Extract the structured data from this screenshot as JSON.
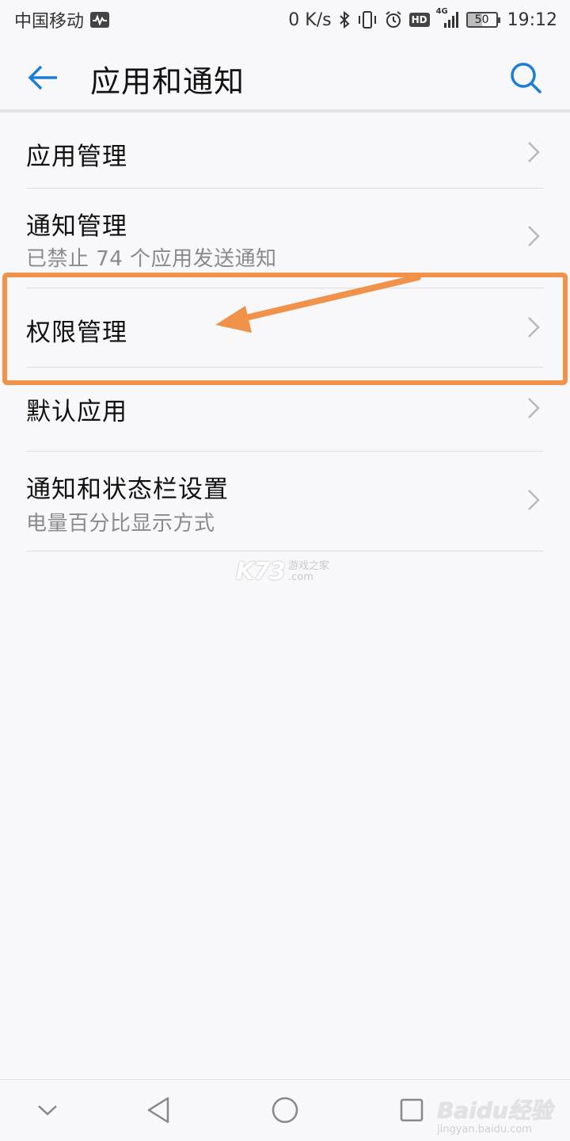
{
  "status_bar": {
    "carrier": "中国移动",
    "network_speed": "0 K/s",
    "hd_label": "HD",
    "signal_label": "4G",
    "battery_level": "50",
    "battery_fraction": 0.5,
    "time": "19:12",
    "icons": [
      "activity-icon",
      "bluetooth-icon",
      "vibrate-icon",
      "alarm-icon",
      "hd-icon",
      "signal-icon",
      "battery-icon"
    ]
  },
  "header": {
    "title": "应用和通知",
    "back_icon": "back-arrow-icon",
    "search_icon": "search-icon"
  },
  "list": {
    "items": [
      {
        "title": "应用管理",
        "subtitle": ""
      },
      {
        "title": "通知管理",
        "subtitle": "已禁止 74 个应用发送通知"
      },
      {
        "title": "权限管理",
        "subtitle": ""
      },
      {
        "title": "默认应用",
        "subtitle": ""
      },
      {
        "title": "通知和状态栏设置",
        "subtitle": "电量百分比显示方式"
      }
    ]
  },
  "annotation": {
    "highlight_color": "#f0924a"
  },
  "watermark": {
    "brand": "K73",
    "line1": "游戏之家",
    "line2": ".com"
  },
  "nav_bar": {
    "icons": [
      "collapse-chevron-icon",
      "back-triangle-icon",
      "home-circle-icon",
      "recents-square-icon"
    ]
  },
  "baidu_watermark": {
    "brand": "Baidu经验",
    "url": "jingyan.baidu.com"
  },
  "colors": {
    "accent": "#1a7fd4",
    "background": "#f8f8fb",
    "annotation": "#f0924a"
  }
}
